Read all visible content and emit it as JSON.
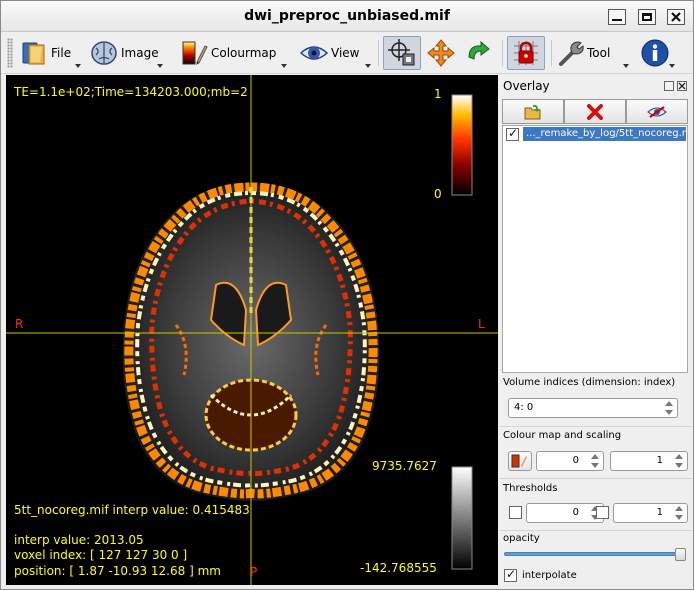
{
  "window": {
    "title": "dwi_preproc_unbiased.mif"
  },
  "toolbar": {
    "file_label": "File",
    "image_label": "Image",
    "colourmap_label": "Colourmap",
    "view_label": "View",
    "tool_label": "Tool"
  },
  "viewport": {
    "info_top": "TE=1.1e+02;Time=134203.000;mb=2",
    "colorbar_top": {
      "max": "1",
      "min": "0"
    },
    "orient_right": "R",
    "orient_left": "L",
    "orient_posterior": "P",
    "overlay_interp": "5tt_nocoreg.mif interp value: 0.415483",
    "interp_value": "interp value: 2013.05",
    "voxel_index": "voxel index: [ 127 127 30 0 ]",
    "position": "position: [ 1.87 -10.93 12.68 ] mm",
    "colorbar_bottom": {
      "max": "9735.7627",
      "min": "-142.768555"
    }
  },
  "overlay_panel": {
    "title": "Overlay",
    "list_items": [
      {
        "label": "..._remake_by_log/5tt_nocoreg.mif",
        "checked": true
      }
    ],
    "volume_label": "Volume indices (dimension: index)",
    "volume_value": "4: 0",
    "colourmap_label": "Colour map and scaling",
    "scale_min": "0",
    "scale_max": "1",
    "thresholds_label": "Thresholds",
    "threshold_min": "0",
    "threshold_max": "1",
    "opacity_label": "opacity",
    "opacity": 1.0,
    "interpolate_label": "interpolate",
    "interpolate_checked": true
  },
  "colors": {
    "overlay_text": "#ffff00",
    "orientation": "#ff2a1a",
    "selection": "#3c78c4"
  }
}
